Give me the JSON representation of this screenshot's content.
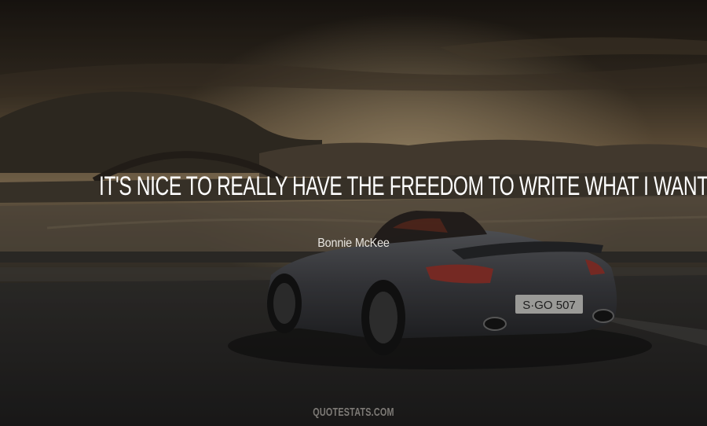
{
  "quote": {
    "text": "It's nice to really have the freedom to write what I want."
  },
  "author": {
    "name": "Bonnie McKee"
  },
  "brand": {
    "site": "QUOTESTATS.COM"
  },
  "car": {
    "plate": "S·GO 507"
  },
  "colors": {
    "sky_top": "#2a231b",
    "sky_glow": "#8f7757",
    "water": "#5b5144",
    "road": "#2b2a2a",
    "car_body": "#4a4b50",
    "tail_light": "#a23a31"
  }
}
